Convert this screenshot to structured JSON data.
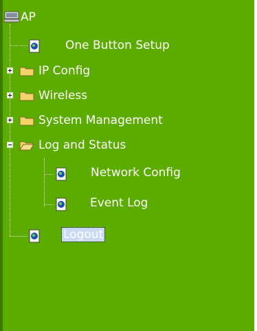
{
  "tree": {
    "root": {
      "label": "AP"
    },
    "items": [
      {
        "label": "One Button Setup"
      },
      {
        "label": "IP Config"
      },
      {
        "label": "Wireless"
      },
      {
        "label": "System Management"
      },
      {
        "label": "Log and Status"
      },
      {
        "label": "Network Config"
      },
      {
        "label": "Event Log"
      },
      {
        "label": "Logout"
      }
    ]
  },
  "colors": {
    "panel": "#5cac00",
    "text": "#ffffff",
    "selected_bg": "#c9d9f7"
  },
  "icons": [
    "computer-icon",
    "page-icon",
    "folder-icon",
    "open-folder-icon",
    "plus-icon",
    "minus-icon"
  ]
}
